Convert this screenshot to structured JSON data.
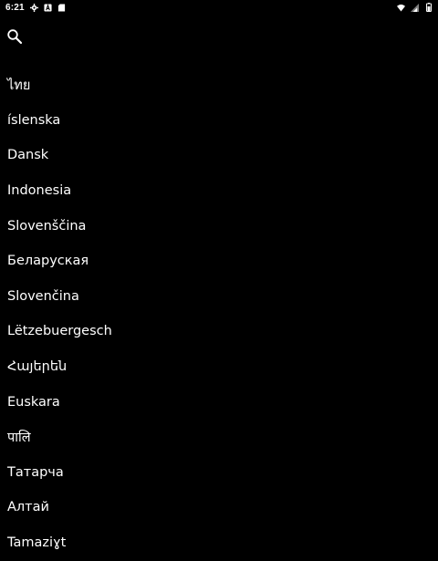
{
  "status_bar": {
    "time": "6:21",
    "left_icons": [
      "settings-gear-icon",
      "a-square-icon",
      "sd-card-icon"
    ],
    "right_icons": [
      "wifi-icon",
      "cell-signal-icon",
      "battery-icon"
    ]
  },
  "toolbar": {
    "search_icon": "search-icon"
  },
  "languages": [
    {
      "label": "ไทย"
    },
    {
      "label": "íslenska"
    },
    {
      "label": "Dansk"
    },
    {
      "label": "Indonesia"
    },
    {
      "label": "Slovenščina"
    },
    {
      "label": "Беларуская"
    },
    {
      "label": "Slovenčina"
    },
    {
      "label": "Lëtzebuergesch"
    },
    {
      "label": "Հայերեն"
    },
    {
      "label": "Euskara"
    },
    {
      "label": "पालि"
    },
    {
      "label": "Татарча"
    },
    {
      "label": "Алтай"
    },
    {
      "label": "Tamaziɣt"
    }
  ],
  "colors": {
    "background": "#000000",
    "text": "#ffffff"
  }
}
